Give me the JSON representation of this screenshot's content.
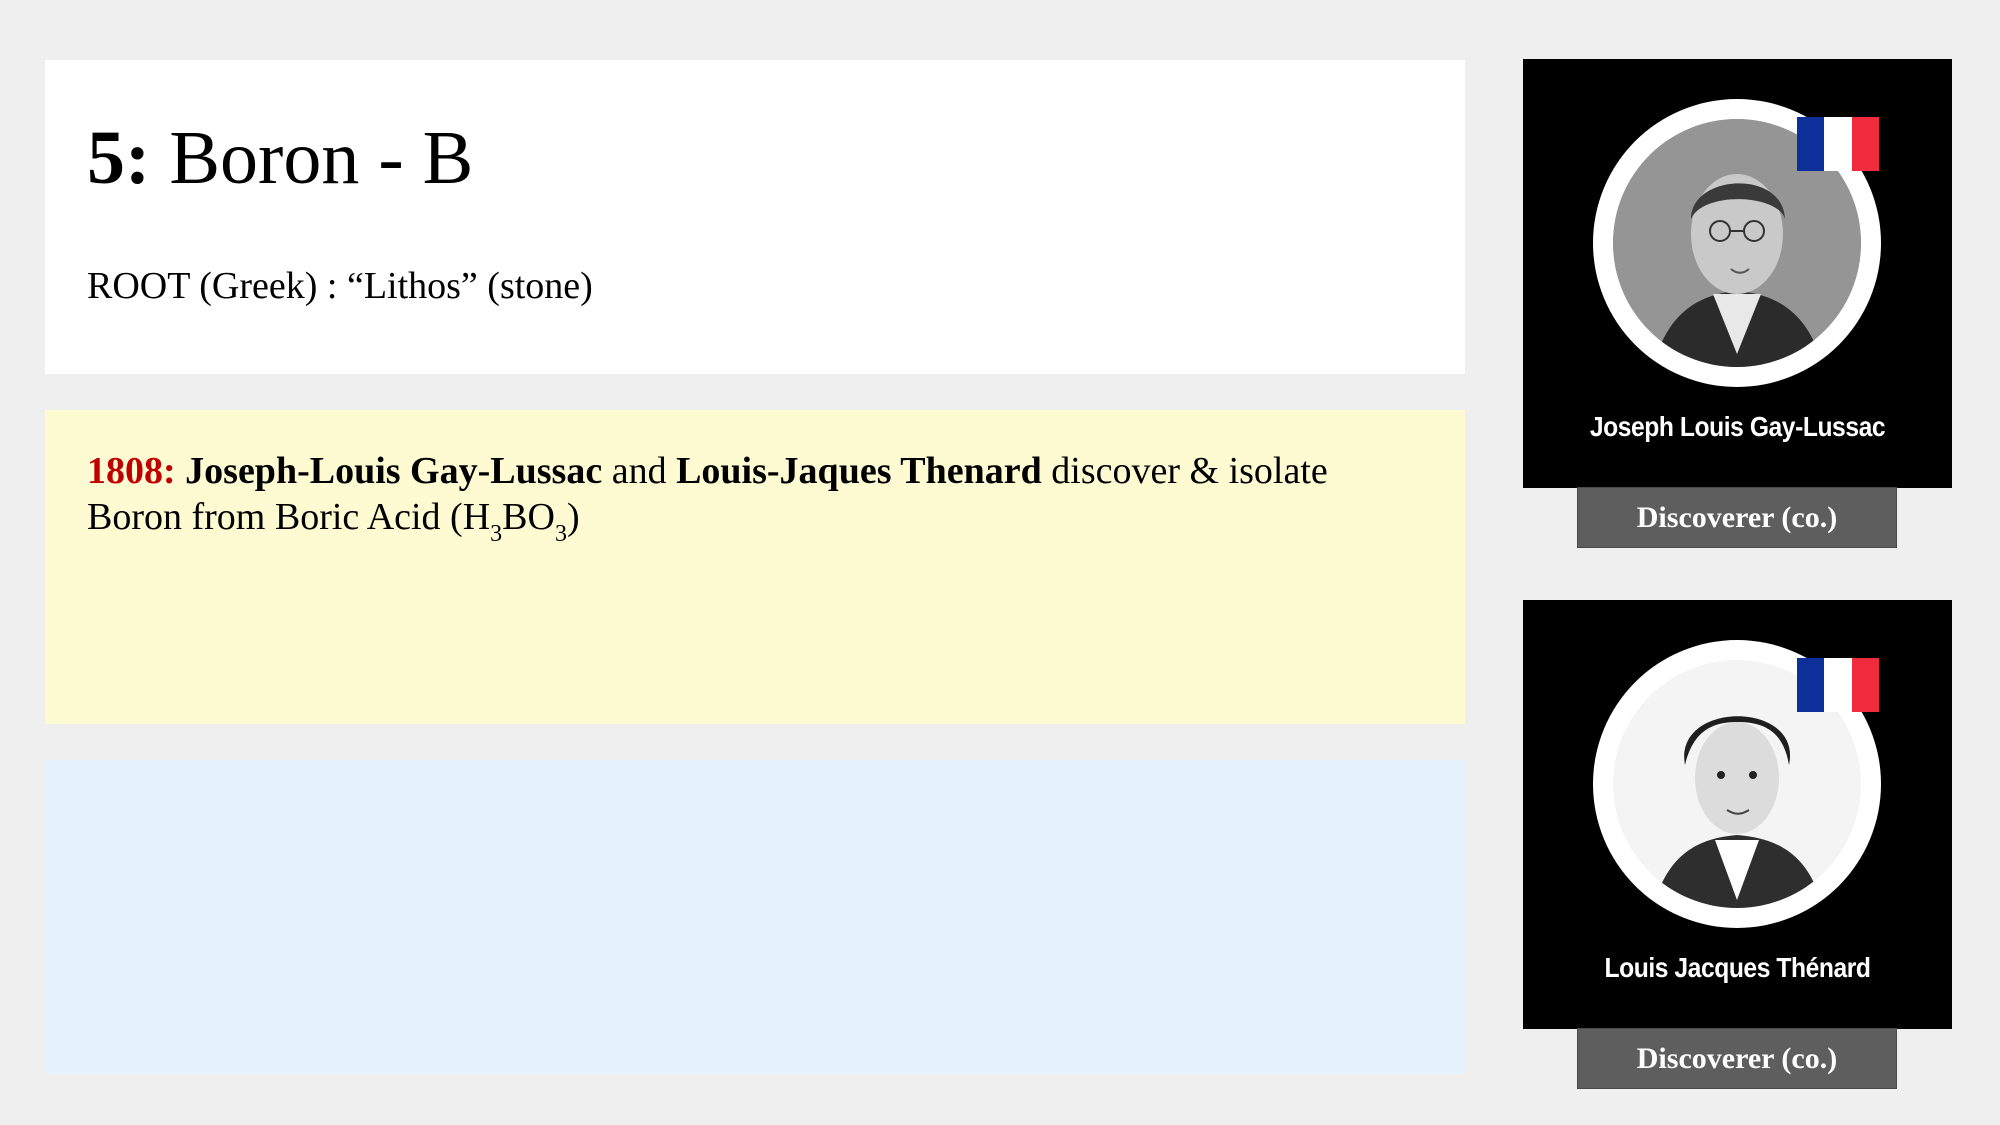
{
  "element": {
    "number_label": "5:",
    "name_label": "Boron - B",
    "root": "ROOT (Greek) : “Lithos” (stone)"
  },
  "history": {
    "year": "1808:",
    "discoverer_1": "Joseph-Louis Gay-Lussac",
    "conjunction": "and",
    "discoverer_2": "Louis-Jaques Thenard",
    "text_1": "discover & isolate Boron from Boric Acid (H",
    "sub_1": "3",
    "text_2": "BO",
    "sub_2": "3",
    "text_3": ")"
  },
  "discoverers": [
    {
      "name": "Joseph Louis Gay-Lussac",
      "role": "Discoverer (co.)",
      "flag": "france-flag-icon"
    },
    {
      "name": "Louis Jacques Thénard",
      "role": "Discoverer (co.)",
      "flag": "france-flag-icon"
    }
  ],
  "colors": {
    "year_accent": "#c00000",
    "history_panel": "#fefbd3",
    "empty_panel": "#e6f3fc",
    "card_bg": "#000000",
    "role_button": "#5e5e5e"
  }
}
